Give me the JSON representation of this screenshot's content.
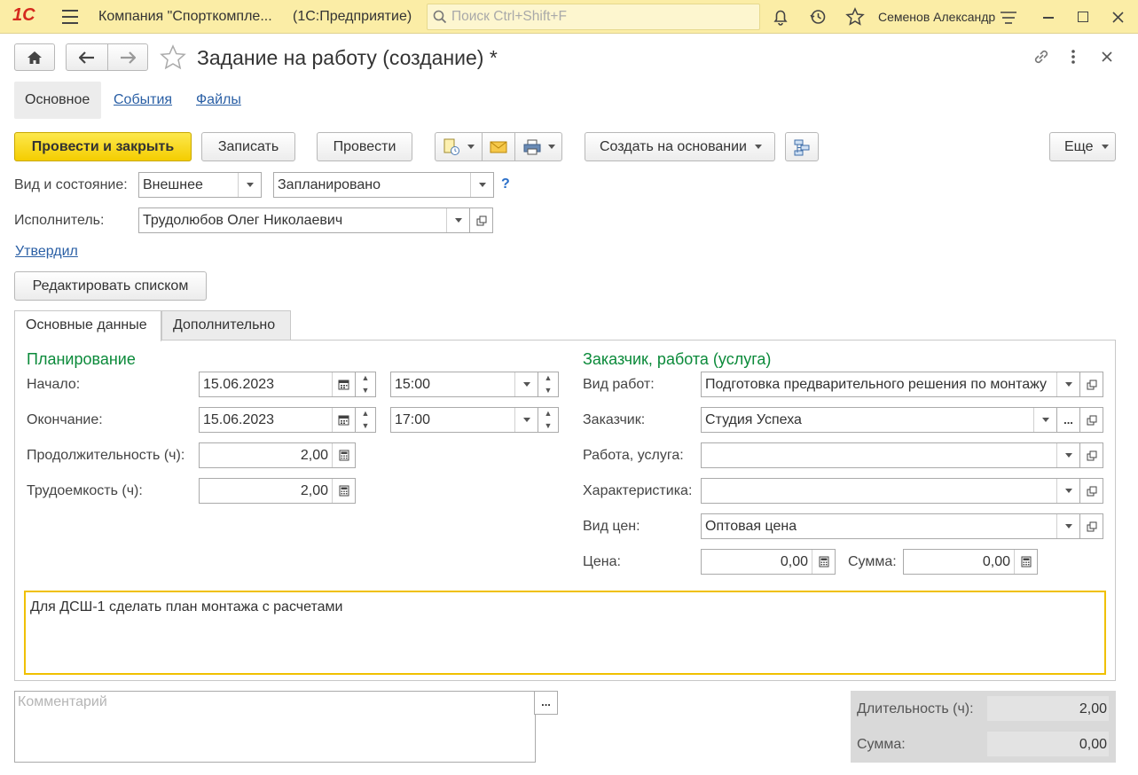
{
  "titlebar": {
    "logo": "1С",
    "company": "Компания \"Спорткомпле...",
    "app": "(1С:Предприятие)",
    "search_placeholder": "Поиск Ctrl+Shift+F",
    "user": "Семенов Александр"
  },
  "doc": {
    "title": "Задание на работу (создание) *"
  },
  "tabs_top": {
    "main": "Основное",
    "events": "События",
    "files": "Файлы"
  },
  "toolbar": {
    "post_close": "Провести и закрыть",
    "save": "Записать",
    "post": "Провести",
    "create_based": "Создать на основании",
    "more": "Еще"
  },
  "form": {
    "kind_state_label": "Вид и состояние:",
    "kind": "Внешнее",
    "state": "Запланировано",
    "help": "?",
    "executor_label": "Исполнитель:",
    "executor": "Трудолюбов Олег Николаевич",
    "approved_link": "Утвердил",
    "edit_list": "Редактировать списком"
  },
  "tabs_inner": {
    "main": "Основные данные",
    "extra": "Дополнительно"
  },
  "planning": {
    "header": "Планирование",
    "start_label": "Начало:",
    "start_date": "15.06.2023",
    "start_time": "15:00",
    "end_label": "Окончание:",
    "end_date": "15.06.2023",
    "end_time": "17:00",
    "duration_label": "Продолжительность (ч):",
    "duration": "2,00",
    "labor_label": "Трудоемкость (ч):",
    "labor": "2,00"
  },
  "customer": {
    "header": "Заказчик, работа (услуга)",
    "work_type_label": "Вид работ:",
    "work_type": "Подготовка предварительного решения по монтажу",
    "customer_label": "Заказчик:",
    "customer": "Студия Успеха",
    "work_label": "Работа, услуга:",
    "work": "",
    "char_label": "Характеристика:",
    "char": "",
    "price_type_label": "Вид цен:",
    "price_type": "Оптовая цена",
    "price_label": "Цена:",
    "price": "0,00",
    "sum_label": "Сумма:",
    "sum": "0,00"
  },
  "description": "Для ДСШ-1 сделать план монтажа с расчетами",
  "comment": {
    "placeholder": "Комментарий",
    "btn": "..."
  },
  "totals": {
    "duration_label": "Длительность (ч):",
    "duration": "2,00",
    "sum_label": "Сумма:",
    "sum": "0,00"
  },
  "colors": {
    "titlebar": "#fbeda6",
    "primary": "#f4cd00",
    "green": "#0b8a3a",
    "link": "#2a5fa5",
    "focus": "#f0c000"
  }
}
